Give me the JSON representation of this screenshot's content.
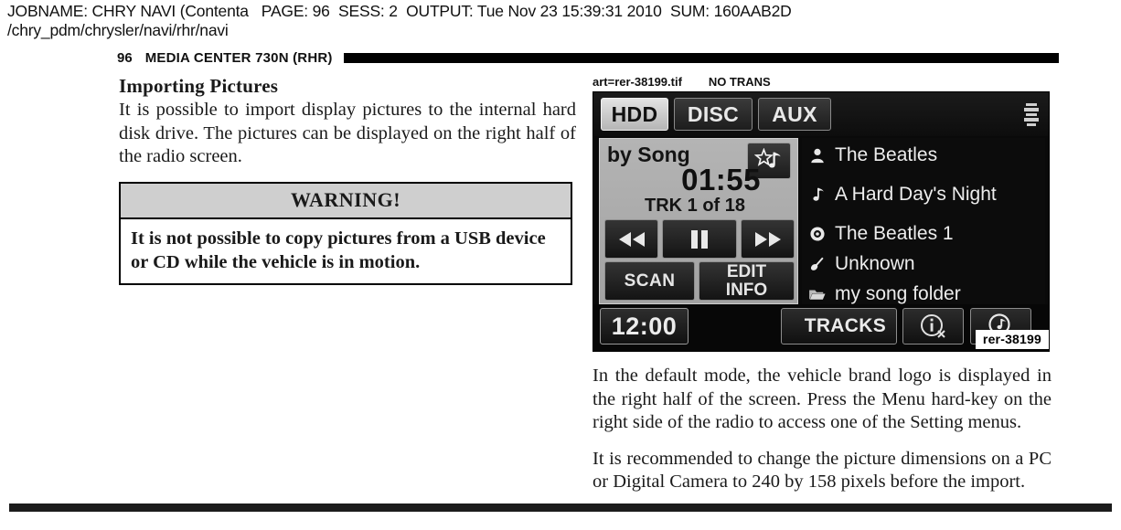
{
  "job_header": {
    "line1": "JOBNAME: CHRY NAVI (Contenta   PAGE: 96  SESS: 2  OUTPUT: Tue Nov 23 15:39:31 2010  SUM: 160AAB2D",
    "line2": "/chry_pdm/chrysler/navi/rhr/navi"
  },
  "running_head": {
    "folio": "96",
    "title": "MEDIA CENTER 730N (RHR)"
  },
  "left_column": {
    "section_title": "Importing Pictures",
    "paragraph1": "It is possible to import display pictures to the internal hard disk drive. The pictures can be displayed on the right half of the radio screen.",
    "warning": {
      "heading": "WARNING!",
      "text": "It is not possible to copy pictures from a USB device or CD while the vehicle is in motion."
    }
  },
  "right_column": {
    "art_caption_top": "art=rer-38199.tif        NO TRANS",
    "art_id": "rer-38199",
    "paragraph1": "In the default mode, the vehicle brand logo is displayed in the right half of the screen. Press the Menu hard-key on the right side of the radio to access one of the Setting menus.",
    "paragraph2": "It is recommended to change the picture dimensions on a PC or Digital Camera to 240 by 158 pixels before the import."
  },
  "radio_screen": {
    "source_tabs": [
      {
        "label": "HDD",
        "selected": true
      },
      {
        "label": "DISC",
        "selected": false
      },
      {
        "label": "AUX",
        "selected": false
      }
    ],
    "now_playing": {
      "mode": "by Song",
      "elapsed_time": "01:55",
      "track_counter": "TRK 1 of 18",
      "favorite_icon": "star-note-icon",
      "prev_label": "rewind-icon",
      "play_label": "pause-icon",
      "next_label": "fast-forward-icon",
      "scan_label": "SCAN",
      "edit_label_line1": "EDIT",
      "edit_label_line2": "INFO"
    },
    "track_info": [
      {
        "icon": "artist-icon",
        "text": "The Beatles"
      },
      {
        "icon": "note-icon",
        "text": "A Hard Day's Night"
      },
      {
        "icon": "disc-icon",
        "text": "The Beatles 1"
      },
      {
        "icon": "genre-icon",
        "text": "Unknown"
      },
      {
        "icon": "folder-icon",
        "text": "my song folder"
      }
    ],
    "bottom_bar": {
      "clock": "12:00",
      "tracks_label": "TRACKS",
      "list_icon": "hamburger-icon",
      "info_icon": "info-disabled-icon",
      "search_icon": "music-search-icon"
    },
    "eq_icon": "equalizer-icon"
  },
  "colors": {
    "page_background": "#ffffff",
    "ink": "#1a1a1a",
    "warning_header_fill": "#cfcfcf",
    "screen_background": "#0a0a0a",
    "panel_fill": "#adadad",
    "screen_text": "#ededed"
  }
}
